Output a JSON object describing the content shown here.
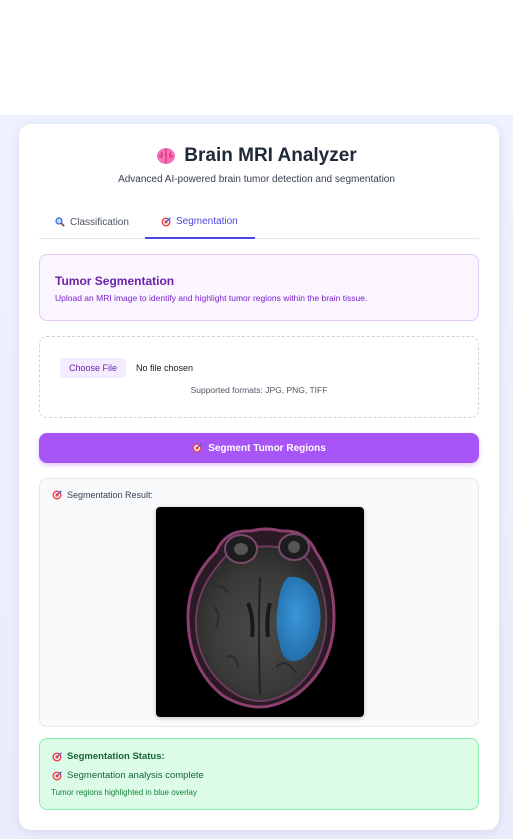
{
  "app": {
    "title": "Brain MRI Analyzer",
    "subtitle": "Advanced AI-powered brain tumor detection and segmentation"
  },
  "tabs": [
    {
      "label": "Classification",
      "icon": "magnifier-icon",
      "active": false
    },
    {
      "label": "Segmentation",
      "icon": "target-icon",
      "active": true
    }
  ],
  "info": {
    "heading": "Tumor Segmentation",
    "description": "Upload an MRI image to identify and highlight tumor regions within the brain tissue."
  },
  "upload": {
    "button_label": "Choose File",
    "file_status": "No file chosen",
    "formats": "Supported formats: JPG, PNG, TIFF"
  },
  "action": {
    "label": "Segment Tumor Regions",
    "icon": "target-icon"
  },
  "result": {
    "label": "Segmentation Result:",
    "icon": "target-icon"
  },
  "status": {
    "heading": "Segmentation Status:",
    "line1": "Segmentation analysis complete",
    "line2": "Tumor regions highlighted in blue overlay"
  },
  "colors": {
    "accent": "#a855f7",
    "active_tab": "#4f46e5",
    "status_green": "#dcfce7",
    "overlay_blue": "#2b8fd6"
  }
}
